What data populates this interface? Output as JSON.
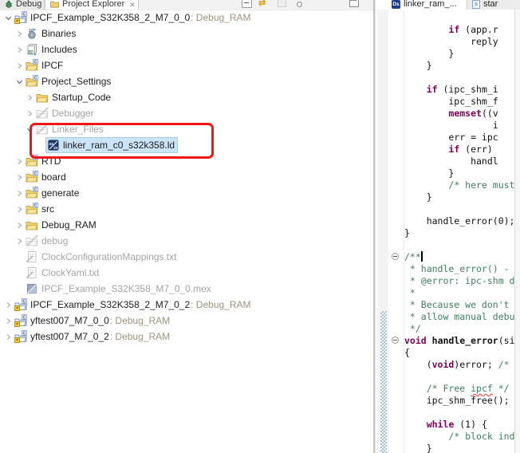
{
  "colors": {
    "selection_bg": "#cbe4f8",
    "annotation_red": "#f01616",
    "keyword": "#7f0055",
    "comment": "#3f7f5f",
    "decoration_text": "#9e937e",
    "range_indicator": "#9fc3de"
  },
  "left_panel": {
    "tabs": {
      "debug": {
        "label": "Debug",
        "icon": "debug-bug-icon"
      },
      "project_explorer": {
        "label": "Project Explorer",
        "icon": "folder-icon",
        "close": "x"
      }
    },
    "toolbar_icons": [
      "collapse-all-icon",
      "link-with-editor-icon",
      "ghost-tab-icon",
      "view-menu-icon",
      "maximize-icon"
    ],
    "tree": [
      {
        "level": 0,
        "chevron": "expanded",
        "icon": "c-project",
        "label": "IPCF_Example_S32K358_2_M7_0_0",
        "suffix": ": Debug_RAM"
      },
      {
        "level": 1,
        "chevron": "collapsed",
        "icon": "binaries",
        "label": "Binaries"
      },
      {
        "level": 1,
        "chevron": "collapsed",
        "icon": "includes",
        "label": "Includes"
      },
      {
        "level": 1,
        "chevron": "collapsed",
        "icon": "folder-c",
        "label": "IPCF"
      },
      {
        "level": 1,
        "chevron": "expanded",
        "icon": "folder-c",
        "label": "Project_Settings"
      },
      {
        "level": 2,
        "chevron": "collapsed",
        "icon": "folder",
        "label": "Startup_Code"
      },
      {
        "level": 2,
        "chevron": "collapsed",
        "icon": "folder-excluded",
        "label": "Debugger",
        "gray": true
      },
      {
        "level": 2,
        "chevron": "expanded",
        "icon": "folder-excluded",
        "label": "Linker_Files",
        "gray": true
      },
      {
        "level": 3,
        "chevron": null,
        "icon": "ld-file",
        "label": "linker_ram_c0_s32k358.ld",
        "selected": true
      },
      {
        "level": 1,
        "chevron": "collapsed",
        "icon": "folder-c",
        "label": "RTD"
      },
      {
        "level": 1,
        "chevron": "collapsed",
        "icon": "folder-c",
        "label": "board"
      },
      {
        "level": 1,
        "chevron": "collapsed",
        "icon": "folder-c",
        "label": "generate"
      },
      {
        "level": 1,
        "chevron": "collapsed",
        "icon": "folder-c",
        "label": "src"
      },
      {
        "level": 1,
        "chevron": "collapsed",
        "icon": "folder",
        "label": "Debug_RAM"
      },
      {
        "level": 1,
        "chevron": "collapsed",
        "icon": "folder-excluded",
        "label": "debug",
        "gray": true
      },
      {
        "level": 1,
        "chevron": null,
        "icon": "txt-file",
        "label": "ClockConfigurationMappings.txt",
        "gray": true
      },
      {
        "level": 1,
        "chevron": null,
        "icon": "txt-file",
        "label": "ClockYaml.txt",
        "gray": true
      },
      {
        "level": 1,
        "chevron": null,
        "icon": "mex-file",
        "label": "IPCF_Example_S32K358_M7_0_0.mex",
        "gray": true
      },
      {
        "level": 0,
        "chevron": "collapsed",
        "icon": "c-project",
        "label": "IPCF_Example_S32K358_2_M7_0_2",
        "suffix": ": Debug_RAM"
      },
      {
        "level": 0,
        "chevron": "collapsed",
        "icon": "c-project",
        "label": "yftest007_M7_0_0",
        "suffix": ": Debug_RAM"
      },
      {
        "level": 0,
        "chevron": "collapsed",
        "icon": "c-project",
        "label": "yftest007_M7_0_2",
        "suffix": ": Debug_RAM"
      }
    ]
  },
  "editor": {
    "tabs": {
      "tab1": {
        "label": "linker_ram_...",
        "icon": "s32ds-file-icon"
      },
      "tab2": {
        "label": "star",
        "icon": "source-file-icon"
      }
    },
    "fold_lines": [
      20,
      27
    ],
    "range_indicator_start_line": 25,
    "lines": [
      [],
      [
        [
          "p",
          "        "
        ],
        [
          "k",
          "if"
        ],
        [
          "p",
          " (app.r"
        ]
      ],
      [
        [
          "p",
          "            reply"
        ]
      ],
      [
        [
          "p",
          "        }"
        ]
      ],
      [
        [
          "p",
          "    }"
        ]
      ],
      [],
      [
        [
          "p",
          "    "
        ],
        [
          "k",
          "if"
        ],
        [
          "p",
          " (ipc_shm_i"
        ]
      ],
      [
        [
          "p",
          "        ipc_shm_f"
        ]
      ],
      [
        [
          "p",
          "        "
        ],
        [
          "k",
          "memset"
        ],
        [
          "p",
          "((v"
        ]
      ],
      [
        [
          "p",
          "                i"
        ]
      ],
      [
        [
          "p",
          "        err = ipc"
        ]
      ],
      [
        [
          "p",
          "        "
        ],
        [
          "k",
          "if"
        ],
        [
          "p",
          " (err)"
        ]
      ],
      [
        [
          "p",
          "            handl"
        ]
      ],
      [
        [
          "p",
          "        }"
        ]
      ],
      [
        [
          "p",
          "        "
        ],
        [
          "c",
          "/* here must "
        ]
      ],
      [
        [
          "p",
          "    }"
        ]
      ],
      [],
      [
        [
          "p",
          "    handle_error(0);"
        ]
      ],
      [
        [
          "p",
          "}"
        ]
      ],
      [],
      [
        [
          "c",
          "/**"
        ],
        [
          "caret",
          ""
        ]
      ],
      [
        [
          "c",
          " * handle_error() - d"
        ]
      ],
      [
        [
          "c",
          " * @error: ipc-shm dr"
        ]
      ],
      [
        [
          "c",
          " *"
        ]
      ],
      [
        [
          "c",
          " * Because we don't h"
        ]
      ],
      [
        [
          "c",
          " * allow manual debug"
        ]
      ],
      [
        [
          "c",
          " */"
        ]
      ],
      [
        [
          "k",
          "void"
        ],
        [
          "p",
          " "
        ],
        [
          "fn",
          "handle_error"
        ],
        [
          "p",
          "(si"
        ]
      ],
      [
        [
          "p",
          "{"
        ]
      ],
      [
        [
          "p",
          "    ("
        ],
        [
          "k",
          "void"
        ],
        [
          "p",
          ")error; "
        ],
        [
          "c",
          "/* s"
        ]
      ],
      [],
      [
        [
          "p",
          "    "
        ],
        [
          "c",
          "/* Free "
        ],
        [
          "csp",
          "ipcf"
        ],
        [
          "c",
          " */"
        ]
      ],
      [
        [
          "p",
          "    ipc_shm_free();"
        ]
      ],
      [],
      [
        [
          "p",
          "    "
        ],
        [
          "k",
          "while"
        ],
        [
          "p",
          " (1) {"
        ]
      ],
      [
        [
          "p",
          "        "
        ],
        [
          "c",
          "/* block inde"
        ]
      ],
      [
        [
          "p",
          "    }"
        ]
      ]
    ]
  }
}
